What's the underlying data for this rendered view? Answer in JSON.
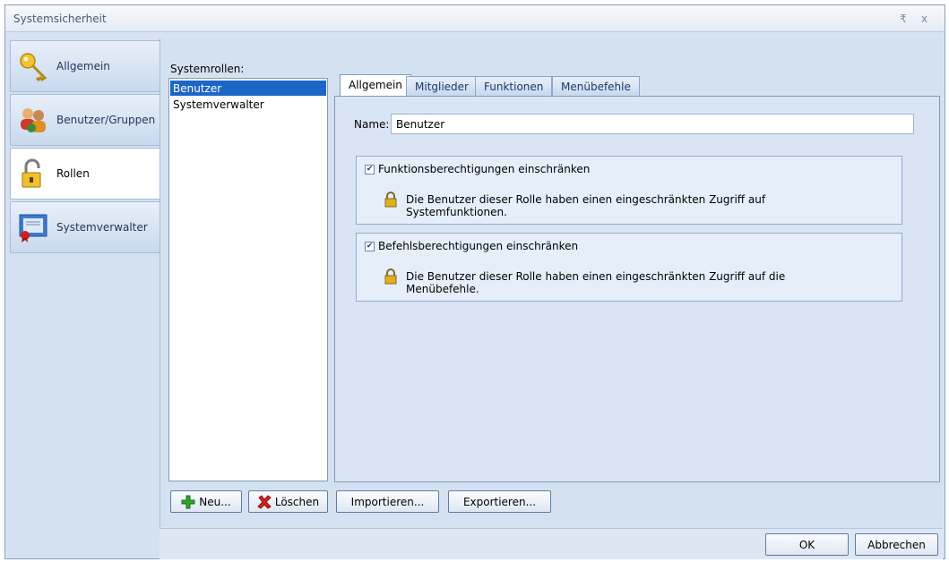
{
  "window": {
    "title": "Systemsicherheit",
    "pin_glyph": "₹",
    "close_glyph": "x"
  },
  "nav": {
    "items": [
      {
        "label": "Allgemein",
        "icon": "key-icon"
      },
      {
        "label": "Benutzer/Gruppen",
        "icon": "users-icon"
      },
      {
        "label": "Rollen",
        "icon": "padlock-open-icon"
      },
      {
        "label": "Systemverwalter",
        "icon": "certificate-icon"
      }
    ],
    "active": "Rollen"
  },
  "roles": {
    "label": "Systemrollen:",
    "items": [
      "Benutzer",
      "Systemverwalter"
    ],
    "selected": "Benutzer"
  },
  "tabs": {
    "items": [
      "Allgemein",
      "Mitglieder",
      "Funktionen",
      "Menübefehle"
    ],
    "active": "Allgemein"
  },
  "general": {
    "name_label": "Name:",
    "name_value": "Benutzer",
    "functions_checkbox": "Funktionsberechtigungen einschränken",
    "functions_info_line1": "Die Benutzer dieser Rolle haben einen eingeschränkten Zugriff auf",
    "functions_info_line2": "Systemfunktionen.",
    "commands_checkbox": "Befehlsberechtigungen einschränken",
    "commands_info_line1": "Die Benutzer dieser Rolle haben einen eingeschränkten Zugriff auf die",
    "commands_info_line2": "Menübefehle.",
    "check_glyph": "✔"
  },
  "buttons": {
    "new": "Neu...",
    "delete": "Löschen",
    "import": "Importieren...",
    "export": "Exportieren...",
    "ok": "OK",
    "cancel": "Abbrechen"
  },
  "colors": {
    "selection": "#1c66c8",
    "panel_bg": "#d4e1f1",
    "add_green": "#2fa42f",
    "delete_red": "#d62020",
    "lock_gold": "#e0b020"
  }
}
